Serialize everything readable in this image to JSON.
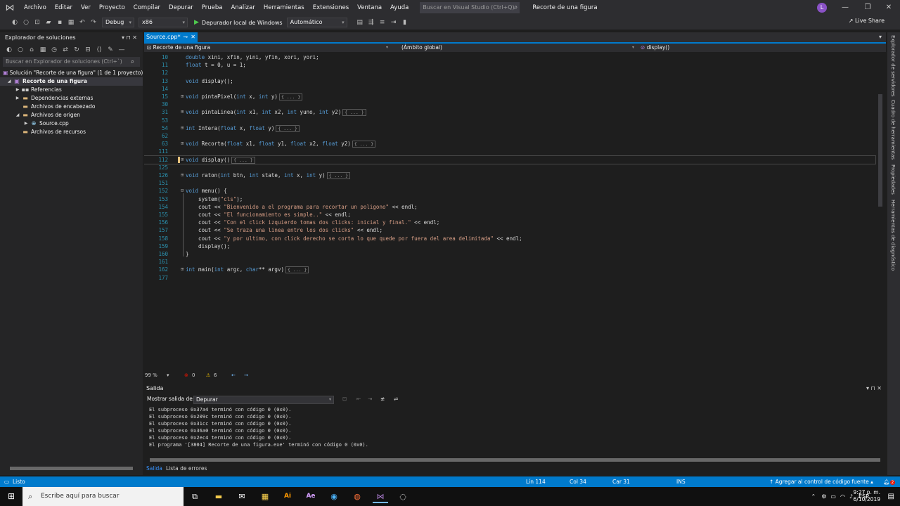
{
  "titlebar": {
    "menu": [
      "Archivo",
      "Editar",
      "Ver",
      "Proyecto",
      "Compilar",
      "Depurar",
      "Prueba",
      "Analizar",
      "Herramientas",
      "Extensiones",
      "Ventana",
      "Ayuda"
    ],
    "search_placeholder": "Buscar en Visual Studio (Ctrl+Q)",
    "window_title": "Recorte de una figura",
    "avatar_letter": "L"
  },
  "toolbar": {
    "config": "Debug",
    "platform": "x86",
    "run_label": "Depurador local de Windows",
    "run_mode": "Automático",
    "liveshare": "Live Share"
  },
  "solution_explorer": {
    "title": "Explorador de soluciones",
    "search_placeholder": "Buscar en Explorador de soluciones (Ctrl+`)",
    "items": [
      {
        "label": "Solución \"Recorte de una figura\" (1 de 1 proyecto)",
        "indent": 0
      },
      {
        "label": "Recorte de una figura",
        "indent": 1
      },
      {
        "label": "Referencias",
        "indent": 2
      },
      {
        "label": "Dependencias externas",
        "indent": 2
      },
      {
        "label": "Archivos de encabezado",
        "indent": 2
      },
      {
        "label": "Archivos de origen",
        "indent": 2
      },
      {
        "label": "Source.cpp",
        "indent": 3
      },
      {
        "label": "Archivos de recursos",
        "indent": 2
      }
    ]
  },
  "editor": {
    "tab_label": "Source.cpp*",
    "nav_project": "Recorte de una figura",
    "nav_scope": "(Ámbito global)",
    "nav_member": "display()",
    "zoom": "99 %",
    "errors": "0",
    "warnings": "6",
    "collapsed_marker": "{ ... }",
    "lines": [
      {
        "n": "10",
        "code": "double xini, xfin, yini, yfin, xori, yori;",
        "fold": ""
      },
      {
        "n": "11",
        "code": "float t = 0, u = 1;",
        "fold": ""
      },
      {
        "n": "12",
        "code": "",
        "fold": ""
      },
      {
        "n": "13",
        "code": "void display();",
        "fold": ""
      },
      {
        "n": "14",
        "code": "",
        "fold": ""
      },
      {
        "n": "15",
        "code": "void pintaPixel(int x, int y)",
        "fold": "⊞",
        "collapsed": true
      },
      {
        "n": "30",
        "code": "",
        "fold": ""
      },
      {
        "n": "31",
        "code": "void pintaLinea(int x1, int x2, int yuno, int y2)",
        "fold": "⊞",
        "collapsed": true
      },
      {
        "n": "53",
        "code": "",
        "fold": ""
      },
      {
        "n": "54",
        "code": "int Intera(float x, float y)",
        "fold": "⊞",
        "collapsed": true
      },
      {
        "n": "62",
        "code": "",
        "fold": ""
      },
      {
        "n": "63",
        "code": "void Recorta(float x1, float y1, float x2, float y2)",
        "fold": "⊞",
        "collapsed": true
      },
      {
        "n": "111",
        "code": "",
        "fold": ""
      },
      {
        "n": "112",
        "code": "void display()",
        "fold": "⊞",
        "collapsed": true,
        "current": true
      },
      {
        "n": "125",
        "code": "",
        "fold": ""
      },
      {
        "n": "126",
        "code": "void raton(int btn, int state, int x, int y)",
        "fold": "⊞",
        "collapsed": true
      },
      {
        "n": "151",
        "code": "",
        "fold": ""
      },
      {
        "n": "152",
        "code": "void menu() {",
        "fold": "⊟"
      },
      {
        "n": "153",
        "code": "    system(\"cls\");",
        "fold": ""
      },
      {
        "n": "154",
        "code": "    cout << \"Bienvenido a el programa para recortar un poligono\" << endl;",
        "fold": ""
      },
      {
        "n": "155",
        "code": "    cout << \"El funcionamiento es simple..\" << endl;",
        "fold": ""
      },
      {
        "n": "156",
        "code": "    cout << \"Con el click izquierdo tomas dos clicks: inicial y final.\" << endl;",
        "fold": ""
      },
      {
        "n": "157",
        "code": "    cout << \"Se traza una linea entre los dos clicks\" << endl;",
        "fold": ""
      },
      {
        "n": "158",
        "code": "    cout << \"y por ultimo, con click derecho se corta lo que quede por fuera del area delimitada\" << endl;",
        "fold": ""
      },
      {
        "n": "159",
        "code": "    display();",
        "fold": ""
      },
      {
        "n": "160",
        "code": "}",
        "fold": ""
      },
      {
        "n": "161",
        "code": "",
        "fold": ""
      },
      {
        "n": "162",
        "code": "int main(int argc, char** argv)",
        "fold": "⊞",
        "collapsed": true
      },
      {
        "n": "177",
        "code": "",
        "fold": ""
      }
    ]
  },
  "output": {
    "title": "Salida",
    "source_label": "Mostrar salida de:",
    "source_value": "Depurar",
    "lines": [
      "El subproceso 0x37a4 terminó con código 0 (0x0).",
      "El subproceso 0x209c terminó con código 0 (0x0).",
      "El subproceso 0x31cc terminó con código 0 (0x0).",
      "El subproceso 0x36a0 terminó con código 0 (0x0).",
      "El subproceso 0x2ec4 terminó con código 0 (0x0).",
      "El programa '[3804] Recorte de una figura.exe' terminó con código 0 (0x0)."
    ],
    "tabs": [
      "Salida",
      "Lista de errores"
    ]
  },
  "side_strip": [
    "Explorador de servidores",
    "Cuadro de herramientas",
    "Propiedades",
    "Herramientas de diagnóstico"
  ],
  "statusbar": {
    "state": "Listo",
    "line": "Lín 114",
    "col": "Col 34",
    "car": "Car 31",
    "ins": "INS",
    "source_control": "Agregar al control de código fuente",
    "notifications": "2"
  },
  "taskbar": {
    "search_placeholder": "Escribe aquí para buscar",
    "lang": "ESP",
    "time": "9:27 p. m.",
    "date": "6/10/2019"
  },
  "colors": {
    "accent": "#007acc",
    "keyword": "#569cd6",
    "string": "#d69d85",
    "line_number": "#2b91af"
  }
}
